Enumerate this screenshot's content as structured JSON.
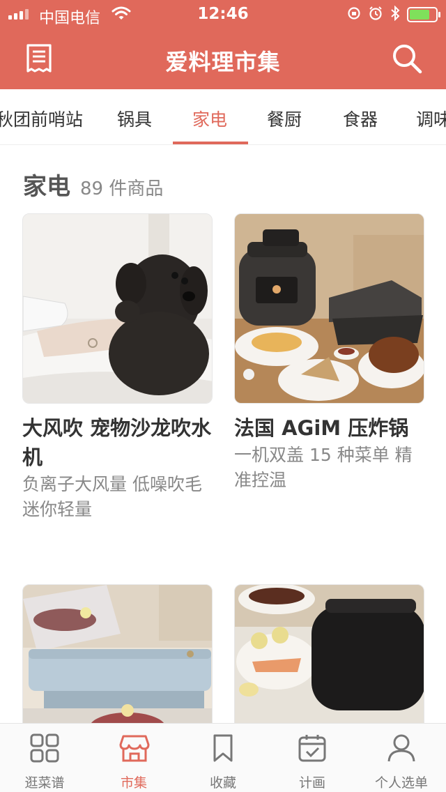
{
  "status_bar": {
    "carrier": "中国电信",
    "time": "12:46"
  },
  "nav": {
    "title": "爱料理市集"
  },
  "tabs": [
    {
      "label": "秋团前哨站"
    },
    {
      "label": "锅具"
    },
    {
      "label": "家电"
    },
    {
      "label": "餐厨"
    },
    {
      "label": "食器"
    },
    {
      "label": "调味"
    }
  ],
  "active_tab": "家电",
  "section": {
    "title": "家电",
    "count": "89 件商品"
  },
  "products": [
    {
      "name": "大风吹 宠物沙龙吹水机",
      "desc": "负离子大风量 低噪吹毛 迷你轻量"
    },
    {
      "name": "法国 AGiM 压炸锅",
      "desc": "一机双盖 15 种菜单 精准控温"
    },
    {
      "name": "",
      "desc": ""
    },
    {
      "name": "",
      "desc": ""
    }
  ],
  "tab_bar": [
    {
      "label": "逛菜谱",
      "icon": "grid-icon"
    },
    {
      "label": "市集",
      "icon": "shop-icon"
    },
    {
      "label": "收藏",
      "icon": "bookmark-icon"
    },
    {
      "label": "计画",
      "icon": "calendar-check-icon"
    },
    {
      "label": "个人选单",
      "icon": "person-icon"
    }
  ],
  "colors": {
    "accent": "#e0695b",
    "battery": "#7fe05b"
  }
}
